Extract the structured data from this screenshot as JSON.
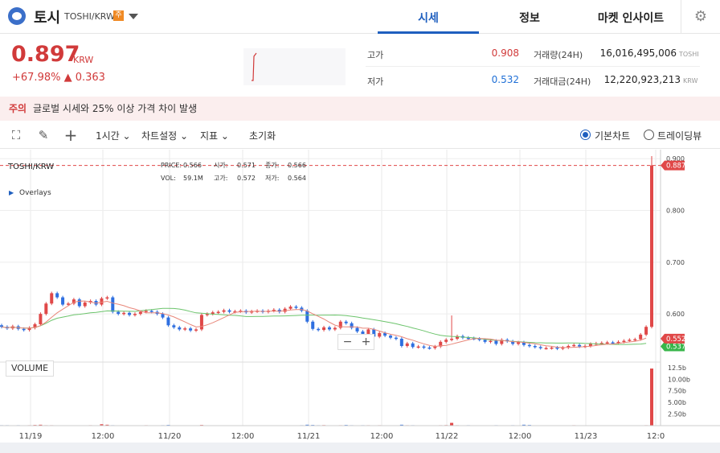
{
  "header": {
    "coin_name": "토시",
    "pair": "TOSHI/KRW",
    "badge": "주",
    "tabs": [
      {
        "label": "시세",
        "active": true
      },
      {
        "label": "정보",
        "active": false
      },
      {
        "label": "마켓 인사이트",
        "active": false
      }
    ]
  },
  "ticker": {
    "price": "0.897",
    "unit": "KRW",
    "change": "+67.98% ▲ 0.363",
    "high_label": "고가",
    "high_value": "0.908",
    "low_label": "저가",
    "low_value": "0.532",
    "volume_label": "거래량(24H)",
    "volume_value": "16,016,495,006",
    "volume_unit": "TOSHI",
    "amount_label": "거래대금(24H)",
    "amount_value": "12,220,923,213",
    "amount_unit": "KRW"
  },
  "warning": {
    "title": "주의",
    "text": "글로벌 시세와 25% 이상 가격 차이 발생"
  },
  "toolbar": {
    "interval": "1시간",
    "chart_settings": "차트설정",
    "indicators": "지표",
    "reset": "초기화",
    "basic_chart": "기본차트",
    "tradingview": "트레이딩뷰"
  },
  "chart_info": {
    "symbol": "TOSHI/KRW",
    "overlays": "Overlays",
    "price_label": "PRICE:",
    "price_value": "0.566",
    "open_label": "시가:",
    "open_value": "0.571",
    "close_label": "종가:",
    "close_value": "0.566",
    "vol_label": "VOL:",
    "vol_value": "59.1M",
    "high_label": "고가:",
    "high_value": "0.572",
    "low_label": "저가:",
    "low_value": "0.564",
    "volume_panel": "VOLUME",
    "zoom_out": "−",
    "zoom_in": "+"
  },
  "chart_data": {
    "type": "candlestick",
    "x_ticks": [
      "11/19",
      "12:00",
      "11/20",
      "12:00",
      "11/21",
      "12:00",
      "11/22",
      "12:00",
      "11/23",
      "12:0"
    ],
    "y_ticks": [
      "0.900",
      "0.800",
      "0.700",
      "0.600"
    ],
    "y_range": [
      0.51,
      0.905
    ],
    "volume_ticks": [
      "12.5b",
      "10.00b",
      "7.50b",
      "5.00b",
      "2.50b"
    ],
    "volume_range": [
      0,
      13
    ],
    "last_price_tag": "0.887",
    "ma_tag_1": "0.5521",
    "ma_tag_2": "0.5373",
    "colors": {
      "up": "#e04848",
      "down": "#2f6fe0",
      "ma_fast": "#e8877a",
      "ma_slow": "#6cc46c"
    },
    "candles": [
      0.575,
      0.572,
      0.576,
      0.571,
      0.569,
      0.573,
      0.58,
      0.6,
      0.62,
      0.64,
      0.632,
      0.618,
      0.62,
      0.628,
      0.615,
      0.622,
      0.625,
      0.618,
      0.63,
      0.632,
      0.604,
      0.6,
      0.602,
      0.598,
      0.6,
      0.604,
      0.606,
      0.604,
      0.6,
      0.593,
      0.578,
      0.574,
      0.57,
      0.572,
      0.568,
      0.57,
      0.598,
      0.6,
      0.603,
      0.604,
      0.607,
      0.604,
      0.605,
      0.606,
      0.603,
      0.605,
      0.606,
      0.604,
      0.606,
      0.608,
      0.604,
      0.61,
      0.614,
      0.612,
      0.606,
      0.585,
      0.571,
      0.569,
      0.574,
      0.57,
      0.573,
      0.585,
      0.582,
      0.573,
      0.566,
      0.558,
      0.57,
      0.556,
      0.563,
      0.558,
      0.554,
      0.552,
      0.538,
      0.543,
      0.536,
      0.537,
      0.535,
      0.534,
      0.537,
      0.546,
      0.55,
      0.552,
      0.557,
      0.554,
      0.553,
      0.552,
      0.55,
      0.546,
      0.548,
      0.542,
      0.55,
      0.547,
      0.542,
      0.545,
      0.54,
      0.538,
      0.536,
      0.534,
      0.534,
      0.535,
      0.533,
      0.535,
      0.538,
      0.54,
      0.537,
      0.538,
      0.542,
      0.543,
      0.544,
      0.545,
      0.544,
      0.546,
      0.548,
      0.55,
      0.551,
      0.56,
      0.575,
      0.887
    ],
    "volumes": [
      0.1,
      0.1,
      0.05,
      0.1,
      0.08,
      0.1,
      0.15,
      0.2,
      0.1,
      0.1,
      0.08,
      0.06,
      0.05,
      0.08,
      0.05,
      0.05,
      0.1,
      0.06,
      0.3,
      0.2,
      0.1,
      0.05,
      0.06,
      0.05,
      0.08,
      0.05,
      0.1,
      0.06,
      0.06,
      0.1,
      0.15,
      0.05,
      0.06,
      0.05,
      0.05,
      0.05,
      0.15,
      0.05,
      0.05,
      0.05,
      0.05,
      0.05,
      0.05,
      0.05,
      0.05,
      0.05,
      0.05,
      0.05,
      0.05,
      0.05,
      0.05,
      0.05,
      0.05,
      0.05,
      0.1,
      0.2,
      0.15,
      0.1,
      0.12,
      0.05,
      0.05,
      0.1,
      0.15,
      0.1,
      0.08,
      0.1,
      0.1,
      0.05,
      0.1,
      0.05,
      0.05,
      0.05,
      0.2,
      0.1,
      0.1,
      0.06,
      0.05,
      0.08,
      0.05,
      0.1,
      0.12,
      0.6,
      0.1,
      0.05,
      0.1,
      0.05,
      0.05,
      0.08,
      0.05,
      0.1,
      0.05,
      0.05,
      0.1,
      0.05,
      0.2,
      0.15,
      0.05,
      0.05,
      0.05,
      0.05,
      0.05,
      0.05,
      0.05,
      0.1,
      0.05,
      0.05,
      0.05,
      0.05,
      0.05,
      0.05,
      0.05,
      0.05,
      0.05,
      0.05,
      0.05,
      0.08,
      0.1,
      12.3
    ]
  }
}
